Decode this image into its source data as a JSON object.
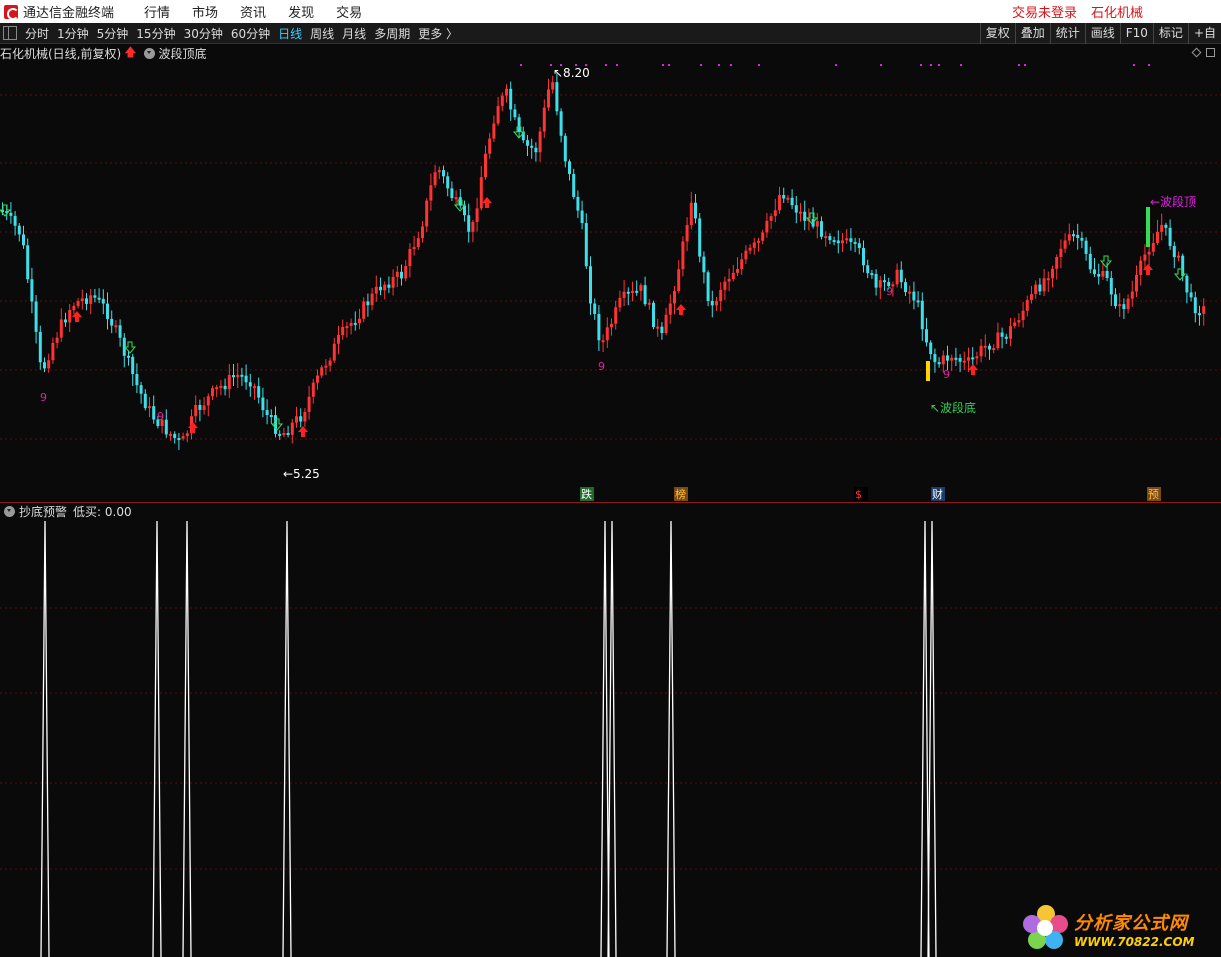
{
  "titlebar": {
    "app_title": "通达信金融终端",
    "menu": [
      "行情",
      "市场",
      "资讯",
      "发现",
      "交易"
    ],
    "trade_status": "交易未登录",
    "stock_name": "石化机械"
  },
  "toolbar": {
    "periods": [
      "分时",
      "1分钟",
      "5分钟",
      "15分钟",
      "30分钟",
      "60分钟",
      "日线",
      "周线",
      "月线",
      "多周期",
      "更多 〉"
    ],
    "active_period": "日线",
    "right_buttons": [
      "复权",
      "叠加",
      "统计",
      "画线",
      "F10",
      "标记",
      "+自"
    ]
  },
  "price_panel": {
    "header_title": "石化机械(日线,前复权)",
    "indicator_name": "波段顶底",
    "high_label": "8.20",
    "low_label": "5.25",
    "top_label": "波段顶",
    "bottom_label": "波段底",
    "nine_label": "9",
    "event_labels": [
      "跌",
      "榜",
      "$",
      "财",
      "预"
    ],
    "colors": {
      "up": "#ff3333",
      "down": "#3de0ea",
      "grid": "#5a1010",
      "top_marker": "#e020e0",
      "bottom_marker": "#33cc55"
    }
  },
  "indicator_panel": {
    "name": "抄底预警",
    "value_label": "低买: 0.00",
    "line_color": "#ffffff"
  },
  "watermark": {
    "name": "分析家公式网",
    "url": "WWW.70822.COM"
  }
}
